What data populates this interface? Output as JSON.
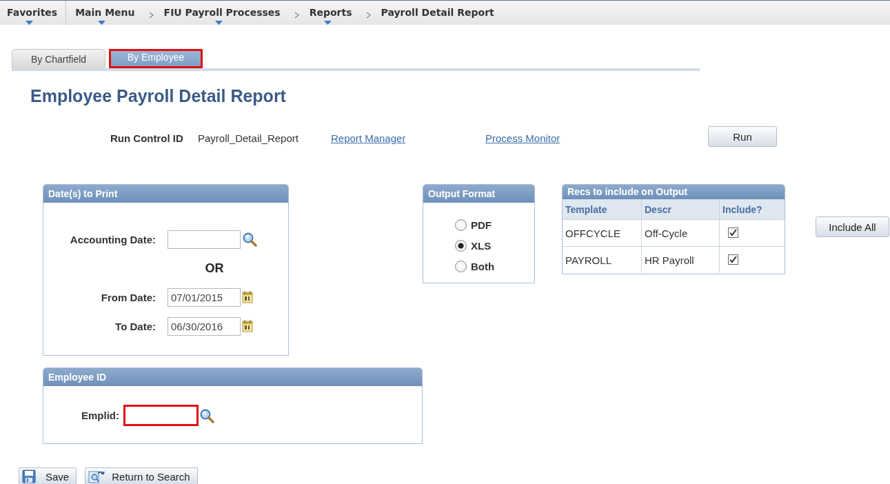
{
  "breadcrumb": [
    {
      "label": "Favorites",
      "menu": true
    },
    {
      "label": "Main Menu",
      "menu": true
    },
    {
      "label": "FIU Payroll Processes",
      "menu": true
    },
    {
      "label": "Reports",
      "menu": true
    },
    {
      "label": "Payroll Detail Report",
      "menu": false
    }
  ],
  "tabs": [
    {
      "label": "By Chartfield",
      "selected": false,
      "highlighted": false
    },
    {
      "label": "By Employee",
      "selected": true,
      "highlighted": true
    }
  ],
  "title": "Employee Payroll Detail Report",
  "run_control": {
    "label": "Run Control ID",
    "value": "Payroll_Detail_Report",
    "links": [
      "Report Manager",
      "Process Monitor"
    ],
    "run_button": "Run"
  },
  "dates": {
    "title": "Date(s) to Print",
    "accounting_date": {
      "label": "Accounting Date:"
    },
    "or": "OR",
    "from_date": {
      "label": "From Date:",
      "value": "07/01/2015"
    },
    "to_date": {
      "label": "To Date:",
      "value": "06/30/2016"
    }
  },
  "output_format": {
    "title": "Output Format",
    "options": [
      {
        "label": "PDF",
        "selected": false
      },
      {
        "label": "XLS",
        "selected": true
      },
      {
        "label": "Both",
        "selected": false
      }
    ]
  },
  "recs": {
    "title": "Recs to include on Output",
    "columns": [
      "Template",
      "Descr",
      "Include?"
    ],
    "rows": [
      {
        "template": "OFFCYCLE",
        "descr": "Off-Cycle",
        "checked": true
      },
      {
        "template": "PAYROLL",
        "descr": "HR Payroll",
        "checked": true
      }
    ]
  },
  "include_all_button": "Include All",
  "employee": {
    "title": "Employee ID",
    "emplid": {
      "label": "Emplid:",
      "highlighted": true
    }
  },
  "footer_buttons": [
    {
      "label": "Save",
      "kind": "save"
    },
    {
      "label": "Return to Search",
      "kind": "return"
    }
  ]
}
